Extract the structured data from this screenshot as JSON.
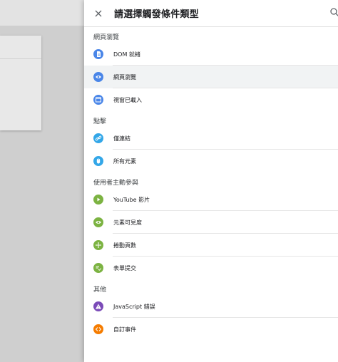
{
  "drawer": {
    "title": "請選擇觸發條件類型"
  },
  "colors": {
    "blue": "#4a86e8",
    "sky": "#33a7e8",
    "green": "#7cb342",
    "purple": "#7b4bb8",
    "orange": "#f57c00"
  },
  "sections": [
    {
      "label": "網頁瀏覽",
      "items": [
        {
          "label": "DOM 就緒",
          "icon": "document-icon",
          "color": "#4a86e8"
        },
        {
          "label": "網頁瀏覽",
          "icon": "eye-icon",
          "color": "#4a86e8",
          "selected": true
        },
        {
          "label": "視窗已載入",
          "icon": "window-icon",
          "color": "#4a86e8"
        }
      ]
    },
    {
      "label": "點擊",
      "items": [
        {
          "label": "僅連結",
          "icon": "link-icon",
          "color": "#33a7e8"
        },
        {
          "label": "所有元素",
          "icon": "mouse-icon",
          "color": "#33a7e8"
        }
      ]
    },
    {
      "label": "使用者主動參與",
      "items": [
        {
          "label": "YouTube 影片",
          "icon": "play-icon",
          "color": "#7cb342"
        },
        {
          "label": "元素可見度",
          "icon": "eye-icon",
          "color": "#7cb342"
        },
        {
          "label": "捲動頁數",
          "icon": "move-arrows-icon",
          "color": "#7cb342"
        },
        {
          "label": "表單提交",
          "icon": "form-check-icon",
          "color": "#7cb342"
        }
      ]
    },
    {
      "label": "其他",
      "items": [
        {
          "label": "JavaScript 錯誤",
          "icon": "warning-icon",
          "color": "#7b4bb8"
        },
        {
          "label": "自訂事件",
          "icon": "code-icon",
          "color": "#f57c00"
        }
      ]
    }
  ]
}
